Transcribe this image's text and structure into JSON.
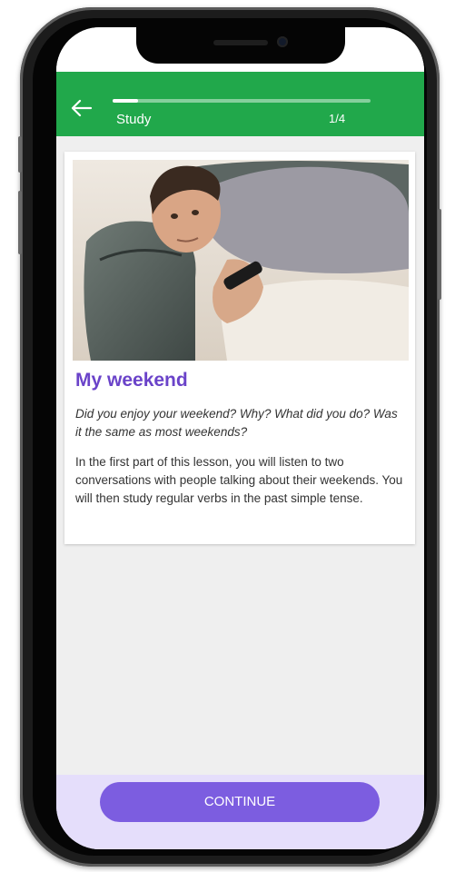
{
  "header": {
    "title": "Study",
    "progress_text": "1/4",
    "progress_fraction": 0.1,
    "back_icon": "arrow-left-icon",
    "color": "#21a84b"
  },
  "card": {
    "title": "My weekend",
    "question": "Did you enjoy your weekend? Why? What did you do? Was it the same as most weekends?",
    "body": "In the first part of this lesson, you will listen to two conversations with people talking about their weekends. You will then study regular verbs in the past simple tense.",
    "title_color": "#6a43c9"
  },
  "footer": {
    "continue_label": "CONTINUE",
    "button_color": "#7c5de0",
    "background": "#e5defb"
  }
}
